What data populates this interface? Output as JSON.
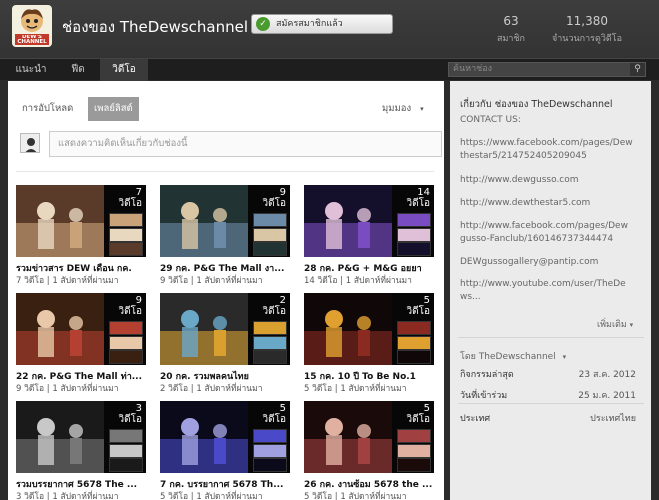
{
  "header": {
    "channel_title": "ช่องของ TheDewschannel",
    "logo_text": "DEW'S CHANNEL",
    "subscribe_label": "สมัครสมาชิกแล้ว",
    "subscribers_count": "63",
    "subscribers_label": "สมาชิก",
    "views_count": "11,380",
    "views_label": "จำนวนการดูวิดีโอ"
  },
  "nav": {
    "tabs": [
      "แนะนำ",
      "ฟีด",
      "วิดีโอ"
    ],
    "search_placeholder": "ค้นหาช่อง"
  },
  "main": {
    "filter_uploads": "การอัปโหลด",
    "filter_playlists": "เพลย์ลิสต์",
    "view_as": "มุมมอง",
    "comment_placeholder": "แสดงความคิดเห็นเกี่ยวกับช่องนี้",
    "playlists": [
      {
        "title": "รวมข่าวสาร DEW เดือน กค.",
        "meta": "7 วิดีโอ | 1 สัปดาห์ที่ผ่านมา",
        "count": "7",
        "count_label": "วิดีโอ"
      },
      {
        "title": "29 กค. P&G The Mall งา...",
        "meta": "9 วิดีโอ | 1 สัปดาห์ที่ผ่านมา",
        "count": "9",
        "count_label": "วิดีโอ"
      },
      {
        "title": "28 กค. P&G + M&G อยยา",
        "meta": "14 วิดีโอ | 1 สัปดาห์ที่ผ่านมา",
        "count": "14",
        "count_label": "วิดีโอ"
      },
      {
        "title": "22 กค. P&G The Mall ท่า...",
        "meta": "9 วิดีโอ | 1 สัปดาห์ที่ผ่านมา",
        "count": "9",
        "count_label": "วิดีโอ"
      },
      {
        "title": "20 กค. รวมพลคนไทย",
        "meta": "2 วิดีโอ | 1 สัปดาห์ที่ผ่านมา",
        "count": "2",
        "count_label": "วิดีโอ"
      },
      {
        "title": "15 กค. 10 ปี To Be No.1",
        "meta": "5 วิดีโอ | 1 สัปดาห์ที่ผ่านมา",
        "count": "5",
        "count_label": "วิดีโอ"
      },
      {
        "title": "รวมบรรยากาศ 5678 The ...",
        "meta": "3 วิดีโอ | 1 สัปดาห์ที่ผ่านมา",
        "count": "3",
        "count_label": "วิดีโอ"
      },
      {
        "title": "7 กค. บรรยากาศ 5678 Th...",
        "meta": "5 วิดีโอ | 1 สัปดาห์ที่ผ่านมา",
        "count": "5",
        "count_label": "วิดีโอ"
      },
      {
        "title": "26 กค. งานซ้อม 5678 the ...",
        "meta": "5 วิดีโอ | 1 สัปดาห์ที่ผ่านมา",
        "count": "5",
        "count_label": "วิดีโอ"
      }
    ]
  },
  "sidebar": {
    "about_title": "เกี่ยวกับ ช่องของ TheDewschannel",
    "contact_label": "CONTACT US:",
    "links": [
      "https://www.facebook.com/pages/Dew",
      "thestar5/214752405209045",
      "http://www.dewgusso.com",
      "http://www.dewthestar5.com",
      "http://www.facebook.com/pages/Dew",
      "gusso-Fanclub/160146737344474",
      "DEWgussogallery@pantip.com",
      "http://www.youtube.com/user/TheDe",
      "ws..."
    ],
    "more_label": "เพิ่มเติม",
    "by_label": "โดย TheDewschannel",
    "rows": [
      {
        "label": "กิจกรรมล่าสุด",
        "value": "23 ส.ค. 2012"
      },
      {
        "label": "วันที่เข้าร่วม",
        "value": "25 ม.ค. 2011"
      },
      {
        "label": "ประเทศ",
        "value": "ประเทศไทย"
      }
    ]
  }
}
